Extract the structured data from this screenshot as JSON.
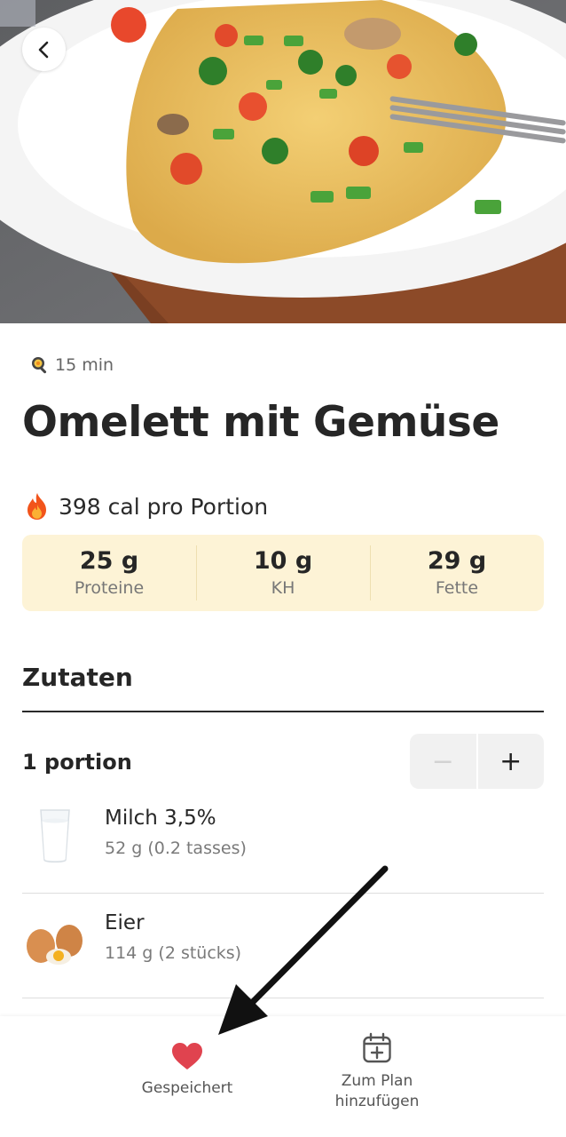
{
  "header": {
    "back_icon": "chevron-left-icon",
    "hero_image": "omelette-with-vegetables-photo"
  },
  "recipe": {
    "time_icon": "frying-pan-emoji",
    "time": "15 min",
    "title": "Omelett mit Gemüse",
    "calories_icon": "fire-emoji",
    "calories": "398 cal pro Portion"
  },
  "macros": [
    {
      "value": "25 g",
      "label": "Proteine"
    },
    {
      "value": "10 g",
      "label": "KH"
    },
    {
      "value": "29 g",
      "label": "Fette"
    }
  ],
  "ingredients_section": {
    "title": "Zutaten",
    "portion_label": "1 portion",
    "minus_label": "−",
    "plus_label": "+",
    "items": [
      {
        "name": "Milch 3,5%",
        "quantity": "52 g (0.2 tasses)",
        "image": "milk-glass"
      },
      {
        "name": "Eier",
        "quantity": "114 g (2 stücks)",
        "image": "eggs"
      }
    ]
  },
  "bottom_nav": {
    "saved_label": "Gespeichert",
    "saved_icon": "heart-icon",
    "plan_label": "Zum Plan\nhinzufügen",
    "plan_icon": "calendar-add-icon"
  },
  "colors": {
    "macro_bg": "#fdf3d6",
    "heart": "#e0434f",
    "text_dark": "#262626"
  }
}
